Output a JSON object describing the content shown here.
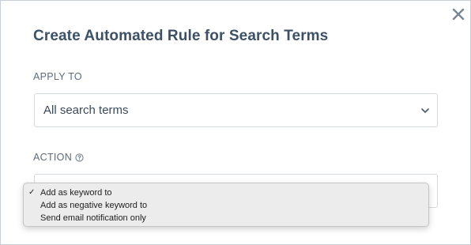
{
  "modal": {
    "title": "Create Automated Rule for Search Terms",
    "close_icon": "close-icon"
  },
  "apply_to": {
    "label": "APPLY TO",
    "selected": "All search terms"
  },
  "action": {
    "label": "ACTION",
    "help_icon": "help-circle-icon",
    "selected": "Add as keyword to",
    "options": [
      {
        "label": "Add as keyword to",
        "checked": true
      },
      {
        "label": "Add as negative keyword to",
        "checked": false
      },
      {
        "label": "Send email notification only",
        "checked": false
      }
    ],
    "check_glyph": "✓"
  }
}
